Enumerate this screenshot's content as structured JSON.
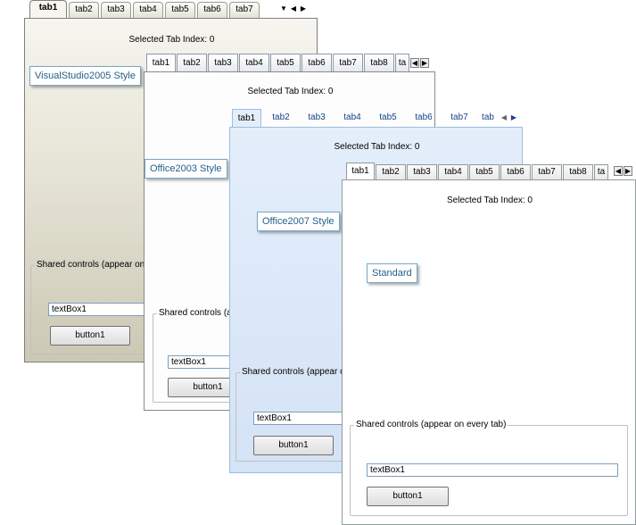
{
  "vs2005": {
    "tabs": [
      "tab1",
      "tab2",
      "tab3",
      "tab4",
      "tab5",
      "tab6",
      "tab7"
    ],
    "overflow_icon": "dropdown-arrow-icon",
    "selected_tab_text": "Selected Tab Index: 0",
    "style_label": "VisualStudio2005 Style",
    "group_legend": "Shared controls (appear on",
    "textbox_value": "textBox1",
    "button_label": "button1"
  },
  "office2003": {
    "tabs": [
      "tab1",
      "tab2",
      "tab3",
      "tab4",
      "tab5",
      "tab6",
      "tab7",
      "tab8",
      "ta"
    ],
    "selected_tab_text": "Selected Tab Index: 0",
    "style_label": "Office2003 Style",
    "group_legend": "Shared controls (ap",
    "textbox_value": "textBox1",
    "button_label": "button1"
  },
  "office2007": {
    "tabs": [
      "tab1",
      "tab2",
      "tab3",
      "tab4",
      "tab5",
      "tab6",
      "tab7",
      "tab"
    ],
    "selected_tab_text": "Selected Tab Index: 0",
    "style_label": "Office2007 Style",
    "group_legend": "Shared controls (appear o",
    "textbox_value": "textBox1",
    "button_label": "button1"
  },
  "standard": {
    "tabs": [
      "tab1",
      "tab2",
      "tab3",
      "tab4",
      "tab5",
      "tab6",
      "tab7",
      "tab8",
      "ta"
    ],
    "selected_tab_text": "Selected Tab Index: 0",
    "style_label": "Standard",
    "group_legend": "Shared controls (appear on every tab)",
    "textbox_value": "textBox1",
    "button_label": "button1"
  },
  "arrows": {
    "left": "◀",
    "right": "▶",
    "dropdown": "▼"
  },
  "colors": {
    "o2007_tab_text": "#15428b",
    "label_text": "#1f5f8b",
    "o2007_panel": "#e4eefb"
  }
}
